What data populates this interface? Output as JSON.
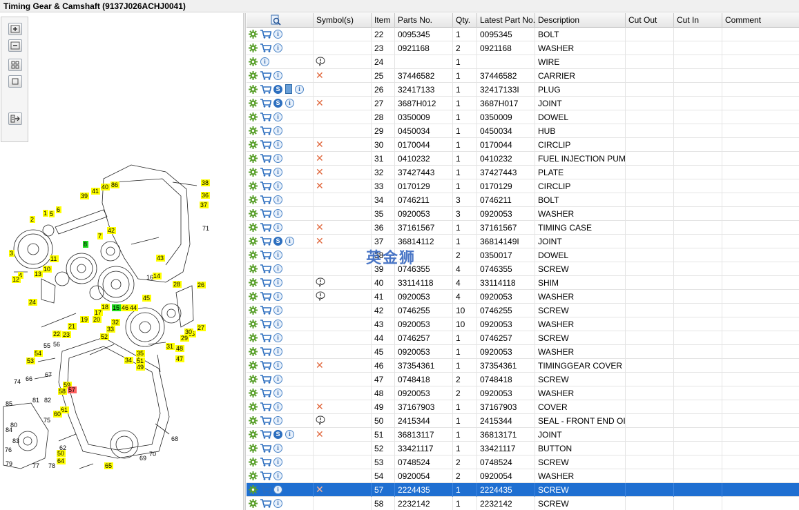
{
  "window": {
    "title": "Timing Gear & Camshaft (9137J026ACHJ0041)"
  },
  "toolbar": {
    "buttons": [
      {
        "name": "zoom-in-button",
        "icon": "zoom-in-icon"
      },
      {
        "name": "zoom-out-button",
        "icon": "zoom-out-icon"
      },
      {
        "name": "fit-window-button",
        "icon": "fit-window-icon"
      },
      {
        "name": "actual-size-button",
        "icon": "actual-size-icon"
      },
      {
        "name": "export-list-button",
        "icon": "export-list-icon"
      }
    ]
  },
  "diagram": {
    "callouts": [
      {
        "t": "38",
        "c": "yellow"
      },
      {
        "t": "36",
        "c": "yellow"
      },
      {
        "t": "37",
        "c": "yellow"
      },
      {
        "t": "40",
        "c": "yellow"
      },
      {
        "t": "86",
        "c": "yellow"
      },
      {
        "t": "41",
        "c": "yellow"
      },
      {
        "t": "39",
        "c": "yellow"
      },
      {
        "t": "1",
        "c": "yellow"
      },
      {
        "t": "5",
        "c": "yellow"
      },
      {
        "t": "6",
        "c": "yellow"
      },
      {
        "t": "2",
        "c": "yellow"
      },
      {
        "t": "71",
        "c": "none"
      },
      {
        "t": "42",
        "c": "yellow"
      },
      {
        "t": "7",
        "c": "yellow"
      },
      {
        "t": "8",
        "c": "green"
      },
      {
        "t": "3",
        "c": "yellow"
      },
      {
        "t": "11",
        "c": "yellow"
      },
      {
        "t": "43",
        "c": "yellow"
      },
      {
        "t": "13",
        "c": "yellow"
      },
      {
        "t": "10",
        "c": "yellow"
      },
      {
        "t": "4",
        "c": "yellow"
      },
      {
        "t": "14",
        "c": "yellow"
      },
      {
        "t": "16",
        "c": "none"
      },
      {
        "t": "12",
        "c": "yellow"
      },
      {
        "t": "28",
        "c": "yellow"
      },
      {
        "t": "26",
        "c": "yellow"
      },
      {
        "t": "45",
        "c": "yellow"
      },
      {
        "t": "24",
        "c": "yellow"
      },
      {
        "t": "18",
        "c": "yellow"
      },
      {
        "t": "15",
        "c": "green"
      },
      {
        "t": "46",
        "c": "yellow"
      },
      {
        "t": "44",
        "c": "yellow"
      },
      {
        "t": "17",
        "c": "yellow"
      },
      {
        "t": "19",
        "c": "yellow"
      },
      {
        "t": "20",
        "c": "yellow"
      },
      {
        "t": "32",
        "c": "yellow"
      },
      {
        "t": "21",
        "c": "yellow"
      },
      {
        "t": "23",
        "c": "yellow"
      },
      {
        "t": "27",
        "c": "yellow"
      },
      {
        "t": "22",
        "c": "yellow"
      },
      {
        "t": "33",
        "c": "yellow"
      },
      {
        "t": "25",
        "c": "yellow"
      },
      {
        "t": "52",
        "c": "yellow"
      },
      {
        "t": "29",
        "c": "yellow"
      },
      {
        "t": "30",
        "c": "yellow"
      },
      {
        "t": "31",
        "c": "yellow"
      },
      {
        "t": "48",
        "c": "yellow"
      },
      {
        "t": "55",
        "c": "none"
      },
      {
        "t": "56",
        "c": "none"
      },
      {
        "t": "54",
        "c": "yellow"
      },
      {
        "t": "35",
        "c": "yellow"
      },
      {
        "t": "53",
        "c": "yellow"
      },
      {
        "t": "34",
        "c": "yellow"
      },
      {
        "t": "51",
        "c": "yellow"
      },
      {
        "t": "47",
        "c": "yellow"
      },
      {
        "t": "49",
        "c": "yellow"
      },
      {
        "t": "67",
        "c": "none"
      },
      {
        "t": "74",
        "c": "none"
      },
      {
        "t": "66",
        "c": "none"
      },
      {
        "t": "59",
        "c": "yellow"
      },
      {
        "t": "58",
        "c": "yellow"
      },
      {
        "t": "57",
        "c": "red"
      },
      {
        "t": "85",
        "c": "none"
      },
      {
        "t": "81",
        "c": "none"
      },
      {
        "t": "82",
        "c": "none"
      },
      {
        "t": "61",
        "c": "yellow"
      },
      {
        "t": "60",
        "c": "yellow"
      },
      {
        "t": "75",
        "c": "none"
      },
      {
        "t": "80",
        "c": "none"
      },
      {
        "t": "84",
        "c": "none"
      },
      {
        "t": "83",
        "c": "none"
      },
      {
        "t": "68",
        "c": "none"
      },
      {
        "t": "62",
        "c": "none"
      },
      {
        "t": "76",
        "c": "none"
      },
      {
        "t": "50",
        "c": "yellow"
      },
      {
        "t": "70",
        "c": "none"
      },
      {
        "t": "64",
        "c": "yellow"
      },
      {
        "t": "69",
        "c": "none"
      },
      {
        "t": "79",
        "c": "none"
      },
      {
        "t": "77",
        "c": "none"
      },
      {
        "t": "78",
        "c": "none"
      },
      {
        "t": "65",
        "c": "yellow"
      }
    ]
  },
  "grid": {
    "headers": {
      "icons": "",
      "symbols": "Symbol(s)",
      "item": "Item",
      "part": "Parts No.",
      "qty": "Qty.",
      "latest": "Latest Part No.",
      "desc": "Description",
      "cutout": "Cut Out",
      "cutin": "Cut In",
      "comment": "Comment"
    },
    "header_icon": "search-document-icon",
    "selected_item": "57",
    "rows": [
      {
        "item": "22",
        "part": "0095345",
        "qty": "1",
        "latest": "0095345",
        "desc": "BOLT",
        "sym": "",
        "cart": true,
        "s": false,
        "doc": false
      },
      {
        "item": "23",
        "part": "0921168",
        "qty": "2",
        "latest": "0921168",
        "desc": "WASHER",
        "sym": "",
        "cart": true,
        "s": false,
        "doc": false
      },
      {
        "item": "24",
        "part": "",
        "qty": "1",
        "latest": "",
        "desc": "WIRE",
        "sym": "bubble",
        "cart": false,
        "s": false,
        "doc": false
      },
      {
        "item": "25",
        "part": "37446582",
        "qty": "1",
        "latest": "37446582",
        "desc": "CARRIER",
        "sym": "x",
        "cart": true,
        "s": false,
        "doc": false
      },
      {
        "item": "26",
        "part": "32417133",
        "qty": "1",
        "latest": "32417133I",
        "desc": "PLUG",
        "sym": "",
        "cart": true,
        "s": true,
        "doc": true
      },
      {
        "item": "27",
        "part": "3687H012",
        "qty": "1",
        "latest": "3687H017",
        "desc": "JOINT",
        "sym": "x",
        "cart": true,
        "s": true,
        "doc": false
      },
      {
        "item": "28",
        "part": "0350009",
        "qty": "1",
        "latest": "0350009",
        "desc": "DOWEL",
        "sym": "",
        "cart": true,
        "s": false,
        "doc": false
      },
      {
        "item": "29",
        "part": "0450034",
        "qty": "1",
        "latest": "0450034",
        "desc": "HUB",
        "sym": "",
        "cart": true,
        "s": false,
        "doc": false
      },
      {
        "item": "30",
        "part": "0170044",
        "qty": "1",
        "latest": "0170044",
        "desc": "CIRCLIP",
        "sym": "x",
        "cart": true,
        "s": false,
        "doc": false
      },
      {
        "item": "31",
        "part": "0410232",
        "qty": "1",
        "latest": "0410232",
        "desc": "FUEL INJECTION PUMP G",
        "sym": "x",
        "cart": true,
        "s": false,
        "doc": false
      },
      {
        "item": "32",
        "part": "37427443",
        "qty": "1",
        "latest": "37427443",
        "desc": "PLATE",
        "sym": "x",
        "cart": true,
        "s": false,
        "doc": false
      },
      {
        "item": "33",
        "part": "0170129",
        "qty": "1",
        "latest": "0170129",
        "desc": "CIRCLIP",
        "sym": "x",
        "cart": true,
        "s": false,
        "doc": false
      },
      {
        "item": "34",
        "part": "0746211",
        "qty": "3",
        "latest": "0746211",
        "desc": "BOLT",
        "sym": "",
        "cart": true,
        "s": false,
        "doc": false
      },
      {
        "item": "35",
        "part": "0920053",
        "qty": "3",
        "latest": "0920053",
        "desc": "WASHER",
        "sym": "",
        "cart": true,
        "s": false,
        "doc": false
      },
      {
        "item": "36",
        "part": "37161567",
        "qty": "1",
        "latest": "37161567",
        "desc": "TIMING CASE",
        "sym": "x",
        "cart": true,
        "s": false,
        "doc": false
      },
      {
        "item": "37",
        "part": "36814112",
        "qty": "1",
        "latest": "36814149I",
        "desc": "JOINT",
        "sym": "x",
        "cart": true,
        "s": true,
        "doc": false
      },
      {
        "item": "38",
        "part": "",
        "qty": "2",
        "latest": "0350017",
        "desc": "DOWEL",
        "sym": "",
        "cart": true,
        "s": false,
        "doc": false
      },
      {
        "item": "39",
        "part": "0746355",
        "qty": "4",
        "latest": "0746355",
        "desc": "SCREW",
        "sym": "",
        "cart": true,
        "s": false,
        "doc": false
      },
      {
        "item": "40",
        "part": "33114118",
        "qty": "4",
        "latest": "33114118",
        "desc": "SHIM",
        "sym": "bubble",
        "cart": true,
        "s": false,
        "doc": false
      },
      {
        "item": "41",
        "part": "0920053",
        "qty": "4",
        "latest": "0920053",
        "desc": "WASHER",
        "sym": "bubble",
        "cart": true,
        "s": false,
        "doc": false
      },
      {
        "item": "42",
        "part": "0746255",
        "qty": "10",
        "latest": "0746255",
        "desc": "SCREW",
        "sym": "",
        "cart": true,
        "s": false,
        "doc": false
      },
      {
        "item": "43",
        "part": "0920053",
        "qty": "10",
        "latest": "0920053",
        "desc": "WASHER",
        "sym": "",
        "cart": true,
        "s": false,
        "doc": false
      },
      {
        "item": "44",
        "part": "0746257",
        "qty": "1",
        "latest": "0746257",
        "desc": "SCREW",
        "sym": "",
        "cart": true,
        "s": false,
        "doc": false
      },
      {
        "item": "45",
        "part": "0920053",
        "qty": "1",
        "latest": "0920053",
        "desc": "WASHER",
        "sym": "",
        "cart": true,
        "s": false,
        "doc": false
      },
      {
        "item": "46",
        "part": "37354361",
        "qty": "1",
        "latest": "37354361",
        "desc": "TIMINGGEAR COVER",
        "sym": "x",
        "cart": true,
        "s": false,
        "doc": false
      },
      {
        "item": "47",
        "part": "0748418",
        "qty": "2",
        "latest": "0748418",
        "desc": "SCREW",
        "sym": "",
        "cart": true,
        "s": false,
        "doc": false
      },
      {
        "item": "48",
        "part": "0920053",
        "qty": "2",
        "latest": "0920053",
        "desc": "WASHER",
        "sym": "",
        "cart": true,
        "s": false,
        "doc": false
      },
      {
        "item": "49",
        "part": "37167903",
        "qty": "1",
        "latest": "37167903",
        "desc": "COVER",
        "sym": "x",
        "cart": true,
        "s": false,
        "doc": false
      },
      {
        "item": "50",
        "part": "2415344",
        "qty": "1",
        "latest": "2415344",
        "desc": "SEAL - FRONT END OIL",
        "sym": "bubble",
        "cart": true,
        "s": false,
        "doc": false
      },
      {
        "item": "51",
        "part": "36813117",
        "qty": "1",
        "latest": "36813171",
        "desc": "JOINT",
        "sym": "x",
        "cart": true,
        "s": true,
        "doc": false
      },
      {
        "item": "52",
        "part": "33421117",
        "qty": "1",
        "latest": "33421117",
        "desc": "BUTTON",
        "sym": "",
        "cart": true,
        "s": false,
        "doc": false
      },
      {
        "item": "53",
        "part": "0748524",
        "qty": "2",
        "latest": "0748524",
        "desc": "SCREW",
        "sym": "",
        "cart": true,
        "s": false,
        "doc": false
      },
      {
        "item": "54",
        "part": "0920054",
        "qty": "2",
        "latest": "0920054",
        "desc": "WASHER",
        "sym": "",
        "cart": true,
        "s": false,
        "doc": false
      },
      {
        "item": "57",
        "part": "2224435",
        "qty": "1",
        "latest": "2224435",
        "desc": "SCREW",
        "sym": "x",
        "cart": true,
        "s": false,
        "doc": false
      },
      {
        "item": "58",
        "part": "2232142",
        "qty": "1",
        "latest": "2232142",
        "desc": "SCREW",
        "sym": "",
        "cart": true,
        "s": false,
        "doc": false
      }
    ]
  },
  "watermark": {
    "text": "英金狮"
  },
  "colors": {
    "selection": "#1f6fd1",
    "callout_yellow": "#ffff00",
    "callout_green": "#22dd22",
    "callout_red": "#ff6060",
    "gear_green": "#5aa02c",
    "cart_blue": "#2d6fbf",
    "cross_orange": "#e0663b"
  }
}
